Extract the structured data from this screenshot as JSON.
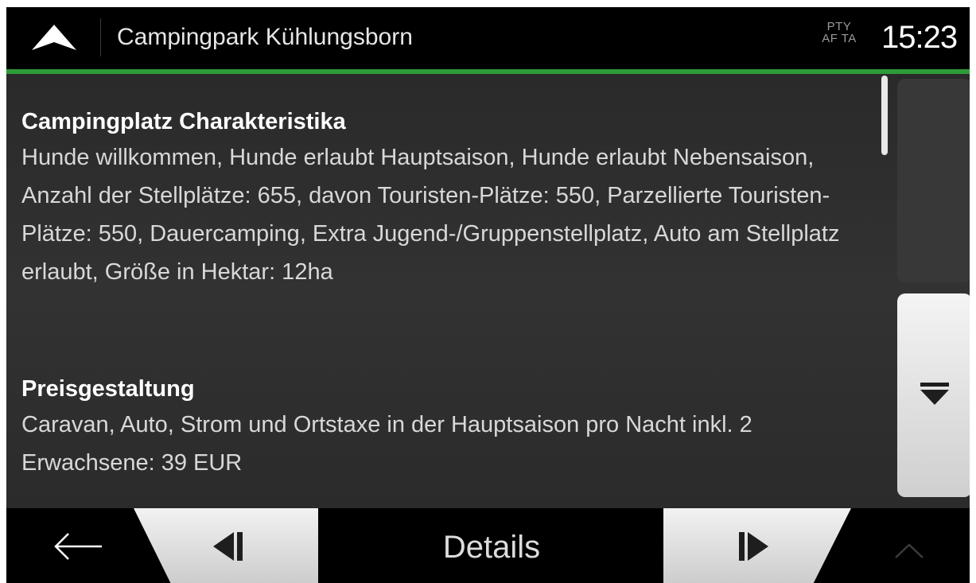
{
  "header": {
    "title": "Campingpark Kühlungsborn",
    "pty_line1": "PTY",
    "pty_line2": "AF TA",
    "clock": "15:23",
    "accent_color": "#2e9a3a"
  },
  "content": {
    "sections": [
      {
        "title": "Campingplatz Charakteristika",
        "text": "Hunde willkommen, Hunde erlaubt Hauptsaison, Hunde erlaubt Nebensaison, Anzahl der Stellplätze: 655, davon Touristen-Plätze: 550, Parzellierte Touristen-Plätze: 550, Dauercamping, Extra Jugend-/Gruppenstellplatz, Auto am Stellplatz erlaubt, Größe in Hektar: 12ha"
      },
      {
        "title": "Preisgestaltung",
        "text": "Caravan, Auto, Strom und Ortstaxe in der Hauptsaison pro Nacht inkl. 2 Erwachsene: 39 EUR"
      }
    ]
  },
  "bottom_bar": {
    "title": "Details"
  },
  "icons": {
    "navigation": "navigation-arrow-icon",
    "back": "back-arrow-icon",
    "previous": "previous-icon",
    "next": "next-icon",
    "scroll_down": "scroll-down-icon",
    "collapse": "chevron-up-icon"
  }
}
